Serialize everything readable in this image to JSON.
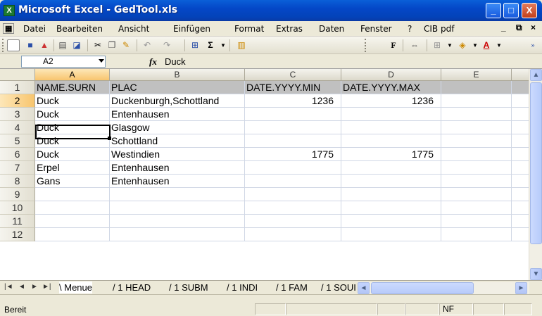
{
  "window": {
    "title": "Microsoft Excel - GedTool.xls",
    "app_icon": "X",
    "minimize": "_",
    "maximize": "□",
    "close": "X"
  },
  "menu": {
    "items": [
      "Datei",
      "Bearbeiten",
      "Ansicht",
      "Einfügen",
      "Format",
      "Extras",
      "Daten",
      "Fenster",
      "?",
      "CIB pdf"
    ],
    "doc_minimize": "_",
    "doc_restore": "⧉",
    "doc_close": "×"
  },
  "toolbar": {
    "sum_label": "Σ",
    "bold_label": "F",
    "font_color_label": "A"
  },
  "formula_bar": {
    "name_box": "A2",
    "fx_label": "fx",
    "content": "Duck"
  },
  "grid": {
    "columns": [
      "A",
      "B",
      "C",
      "D",
      "E"
    ],
    "selected_column": "A",
    "row_numbers": [
      "1",
      "2",
      "3",
      "4",
      "5",
      "6",
      "7",
      "8",
      "9",
      "10",
      "11",
      "12"
    ],
    "selected_row": "2",
    "rows": [
      [
        "NAME.SURN",
        "PLAC",
        "DATE.YYYY.MIN",
        "DATE.YYYY.MAX",
        ""
      ],
      [
        "Duck",
        "Duckenburgh,Schottland",
        "1236",
        "1236",
        ""
      ],
      [
        "Duck",
        "Entenhausen",
        "",
        "",
        ""
      ],
      [
        "Duck",
        "Glasgow",
        "",
        "",
        ""
      ],
      [
        "Duck",
        "Schottland",
        "",
        "",
        ""
      ],
      [
        "Duck",
        "Westindien",
        "1775",
        "1775",
        ""
      ],
      [
        "Erpel",
        "Entenhausen",
        "",
        "",
        ""
      ],
      [
        "Gans",
        "Entenhausen",
        "",
        "",
        ""
      ],
      [
        "",
        "",
        "",
        "",
        ""
      ],
      [
        "",
        "",
        "",
        "",
        ""
      ],
      [
        "",
        "",
        "",
        "",
        ""
      ],
      [
        "",
        "",
        "",
        "",
        ""
      ]
    ]
  },
  "sheets": {
    "nav": [
      "|◄",
      "◄",
      "►",
      "►|"
    ],
    "tabs": [
      "Menue",
      "1 HEAD",
      "1 SUBM",
      "1 INDI",
      "1 FAM",
      "1 SOUI"
    ],
    "active": "Menue"
  },
  "status": {
    "text": "Bereit",
    "indicator": "NF"
  }
}
